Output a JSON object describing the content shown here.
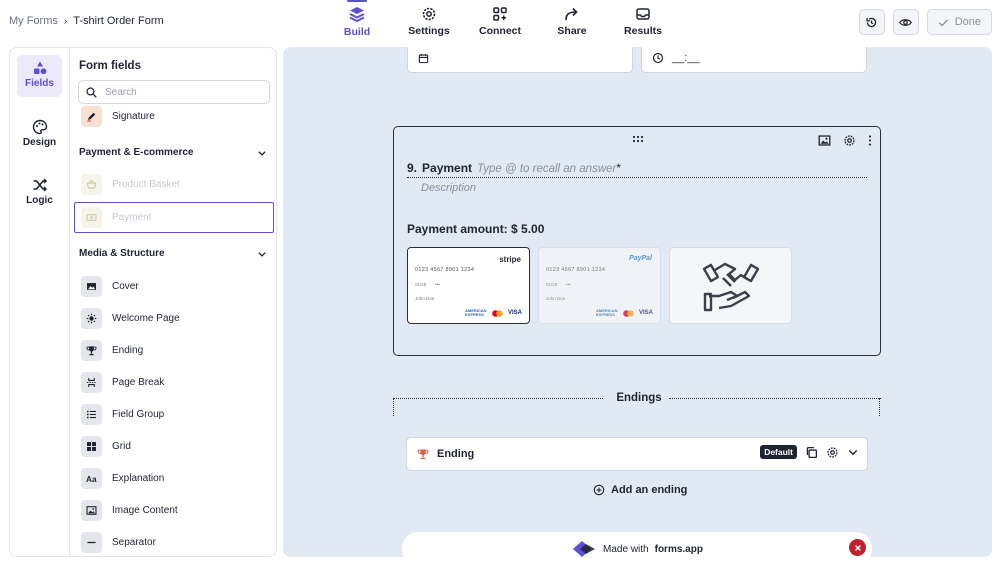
{
  "breadcrumb": {
    "root": "My Forms",
    "separator": "›",
    "current": "T-shirt Order Form"
  },
  "nav": {
    "build": "Build",
    "settings": "Settings",
    "connect": "Connect",
    "share": "Share",
    "results": "Results"
  },
  "actions": {
    "done": "Done"
  },
  "rail": {
    "fields": "Fields",
    "design": "Design",
    "logic": "Logic"
  },
  "panel": {
    "title": "Form fields",
    "search_placeholder": "Search",
    "signature": "Signature",
    "payment_section": "Payment & E-commerce",
    "product_basket": "Product Basket",
    "payment": "Payment",
    "media_section": "Media & Structure",
    "media_items": [
      "Cover",
      "Welcome Page",
      "Ending",
      "Page Break",
      "Field Group",
      "Grid",
      "Explanation",
      "Image Content",
      "Separator"
    ]
  },
  "canvas": {
    "time_placeholder": "__:__",
    "question": {
      "number": "9.",
      "title": "Payment",
      "hint": "Type @ to recall an answer",
      "required": "*",
      "description": "Description",
      "amount": "Payment amount: $ 5.00"
    },
    "card": {
      "number": "0123 4567 8901 1234",
      "expiry": "01/28",
      "cvc": "•••",
      "name": "John Doe",
      "stripe": "stripe",
      "paypal": "PayPal",
      "amex": "AMERICAN EXPRESS",
      "visa": "VISA"
    },
    "endings_label": "Endings",
    "ending": {
      "title": "Ending",
      "badge": "Default"
    },
    "add_ending": "Add an ending",
    "made_with": {
      "prefix": "Made with",
      "brand": "forms.app"
    }
  },
  "colors": {
    "accent": "#5b4fd6",
    "canvas": "#e1e9f3",
    "danger": "#c0212f"
  }
}
